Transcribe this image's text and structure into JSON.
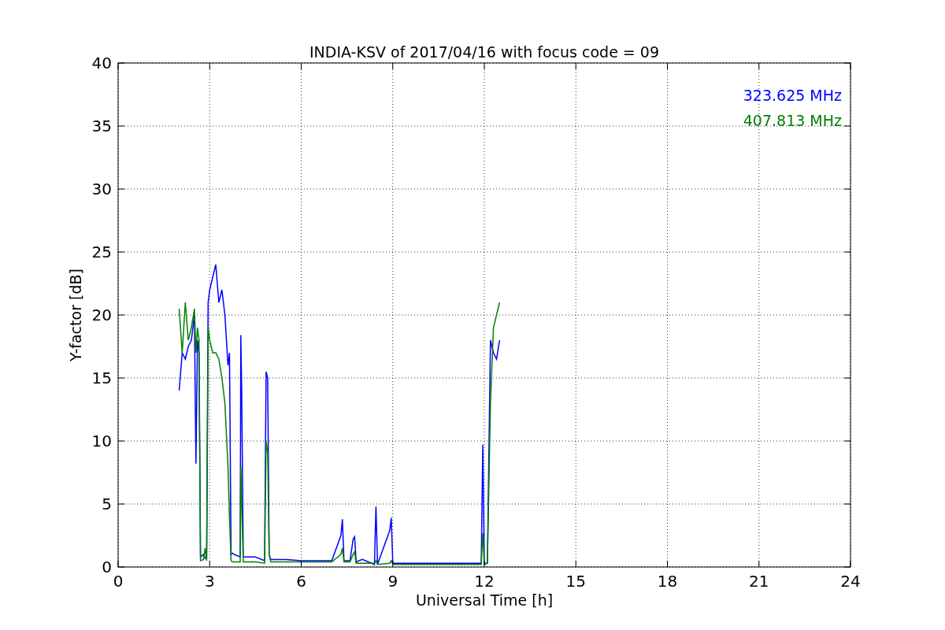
{
  "chart": {
    "chart_data": {
      "type": "line",
      "title": "INDIA-KSV of 2017/04/16 with focus code = 09",
      "xlabel": "Universal Time [h]",
      "ylabel": "Y-factor [dB]",
      "x": [
        2.0,
        2.1,
        2.2,
        2.3,
        2.4,
        2.5,
        2.55,
        2.6,
        2.65,
        2.7,
        2.8,
        2.85,
        2.9,
        2.95,
        3.0,
        3.1,
        3.2,
        3.3,
        3.4,
        3.5,
        3.6,
        3.65,
        3.7,
        3.75,
        3.8,
        4.0,
        4.02,
        4.05,
        4.1,
        4.5,
        4.8,
        4.85,
        4.9,
        4.95,
        5.0,
        5.5,
        6.0,
        6.5,
        7.0,
        7.3,
        7.35,
        7.4,
        7.6,
        7.7,
        7.75,
        7.8,
        8.0,
        8.4,
        8.45,
        8.5,
        8.9,
        8.95,
        9.0,
        9.05,
        9.5,
        10,
        11,
        11.9,
        11.95,
        12.0,
        12.1,
        12.2,
        12.3,
        12.4,
        12.5
      ],
      "series": [
        {
          "name": "323.625 MHz",
          "color": "#0000ff",
          "values": [
            14,
            17,
            16.5,
            17.5,
            18,
            20,
            8.2,
            18,
            17,
            0.8,
            1,
            0.7,
            0.8,
            21,
            22,
            23,
            24,
            21,
            22,
            20,
            16,
            17,
            1,
            1.1,
            1,
            0.8,
            18.4,
            14,
            0.8,
            0.8,
            0.5,
            15.5,
            15,
            1,
            0.6,
            0.6,
            0.5,
            0.5,
            0.5,
            2.5,
            3.8,
            0.5,
            0.5,
            2.2,
            2.4,
            0.4,
            0.6,
            0.2,
            4.8,
            0.2,
            2.9,
            3.9,
            0.3,
            0.3,
            0.3,
            0.3,
            0.3,
            0.3,
            9.7,
            0.3,
            0.3,
            18,
            17,
            16.5,
            18
          ]
        },
        {
          "name": "407.813 MHz",
          "color": "#008000",
          "values": [
            20.5,
            17,
            21,
            18,
            19,
            20.5,
            17,
            19,
            18,
            0.5,
            0.6,
            1.5,
            0.5,
            19,
            18,
            17,
            17,
            16.5,
            15,
            13,
            8,
            4,
            0.5,
            0.4,
            0.4,
            0.4,
            8,
            5,
            0.4,
            0.4,
            0.3,
            10,
            9,
            1,
            0.4,
            0.4,
            0.4,
            0.4,
            0.4,
            1,
            1.5,
            0.4,
            0.4,
            1,
            1.2,
            0.3,
            0.3,
            0.3,
            0.5,
            0.2,
            0.3,
            0.5,
            0.2,
            0.2,
            0.2,
            0.2,
            0.2,
            0.2,
            2.7,
            0.2,
            0.3,
            13,
            19,
            20,
            21
          ]
        }
      ],
      "grid": true,
      "xlim": [
        0,
        24
      ],
      "ylim": [
        0,
        40
      ],
      "xticks": [
        0,
        3,
        6,
        9,
        12,
        15,
        18,
        21,
        24
      ],
      "yticks": [
        0,
        5,
        10,
        15,
        20,
        25,
        30,
        35,
        40
      ]
    }
  }
}
